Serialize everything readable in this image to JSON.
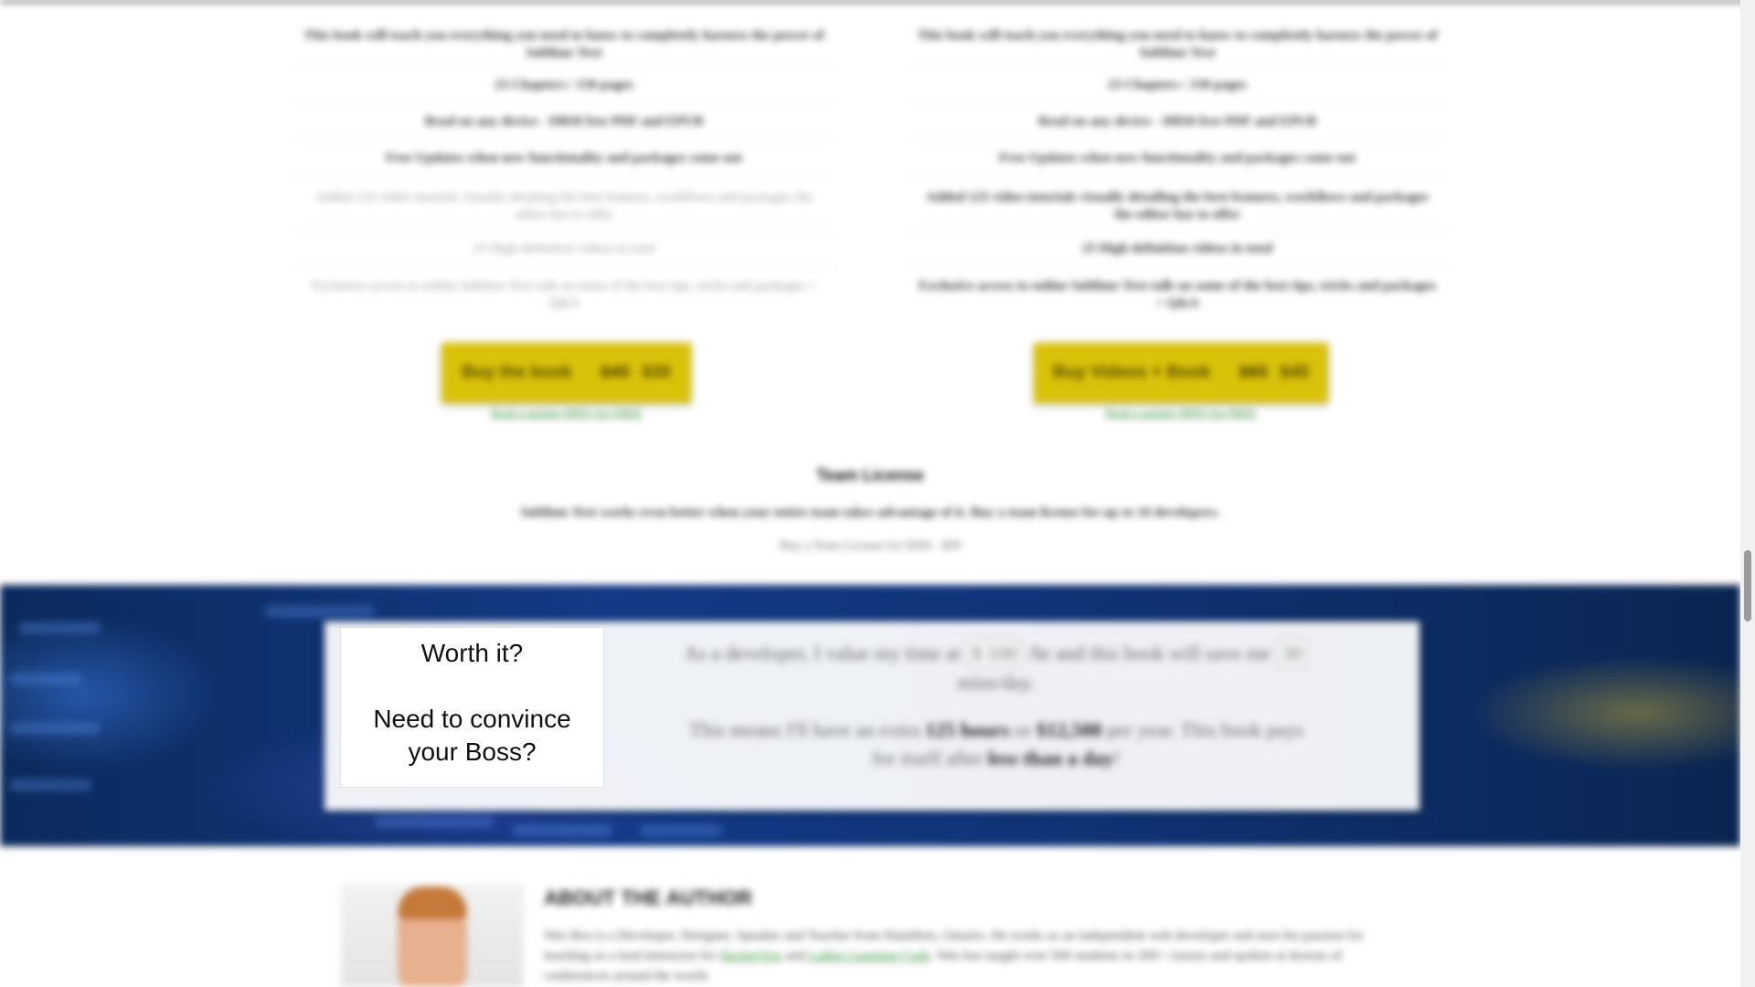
{
  "pricing": {
    "left": {
      "features": [
        "This book will teach you everything you need to know to completely harness the power of Sublime Text",
        "23 Chapters / 150 pages",
        "Read on any device - DRM free PDF and EPUB",
        "Free Updates when new functionality and packages come out",
        "Added 125 video tutorials visually detailing the best features, workflows and packages the editor has to offer",
        "25 High definition videos in total",
        "Exclusive access to online Sublime Text talk on some of the best tips, tricks and packages + Q&A"
      ],
      "button": {
        "label": "Buy the book",
        "price_old": "$40",
        "price_new": "$30"
      },
      "sample_link": "Read a sample (BPA) for FREE"
    },
    "right": {
      "features": [
        "This book will teach you everything you need to know to completely harness the power of Sublime Text",
        "23 Chapters / 150 pages",
        "Read on any device - DRM free PDF and EPUB",
        "Free Updates when new functionality and packages come out",
        "Added 125 video tutorials visually detailing the best features, workflows and packages the editor has to offer",
        "25 High definition videos in total",
        "Exclusive access to online Sublime Text talk on some of the best tips, tricks and packages + Q&A"
      ],
      "button": {
        "label": "Buy Videos + Book",
        "price_old": "$65",
        "price_new": "$45"
      },
      "sample_link": "Read a sample (BPA) for FREE"
    }
  },
  "team": {
    "title": "Team License",
    "text": "Sublime Text works even better when your entire team takes advantage of it. Buy a team license for up to 10 developers.",
    "link": "Buy a Team License for $300 - $99"
  },
  "calculator": {
    "line1_prefix": "As a developer, I value my time at",
    "rate": "$ 100",
    "line1_mid": "/hr and this book will save me",
    "minutes": "30",
    "line1_suffix": "mins/day.",
    "line2_prefix": "This means I'll have an extra",
    "hours": "125 hours",
    "line2_or": "or",
    "money": "$12,500",
    "line2_mid": "per year. This book pays for itself after",
    "payback": "less than a day",
    "line2_end": "!"
  },
  "modal": {
    "title": "Worth it?",
    "subtitle": "Need to convince your Boss?"
  },
  "author": {
    "heading": "ABOUT THE AUTHOR",
    "bio_start": "Wes Bos is a Developer, Designer, Speaker and Teacher from Hamilton, Ontario. He works as an independent web developer and uses his passion for teaching as a lead instructor for",
    "link1": "HackerYou",
    "bio_and": "and",
    "link2": "Ladies Learning Code",
    "bio_end": ". Wes has taught over 500 students in 200+ classes and spoken at dozens of conferences around the world."
  },
  "colors": {
    "button": "#d9c20a",
    "banner": "#123a86",
    "link": "#2f8a2f"
  }
}
